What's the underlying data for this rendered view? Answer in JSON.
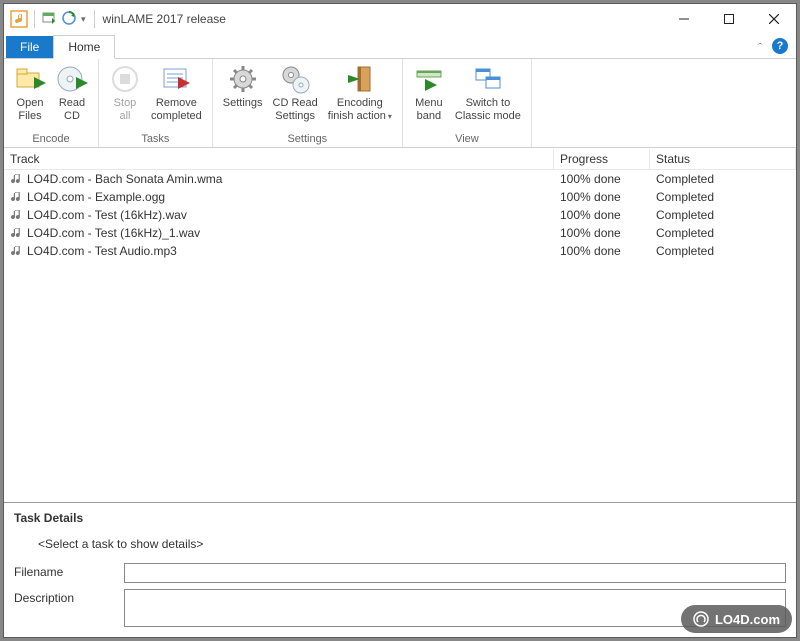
{
  "window": {
    "title": "winLAME 2017 release"
  },
  "tabs": {
    "file": "File",
    "home": "Home"
  },
  "ribbon": {
    "groups": {
      "encode": {
        "label": "Encode",
        "open_files": "Open\nFiles",
        "read_cd": "Read\nCD"
      },
      "tasks": {
        "label": "Tasks",
        "stop_all": "Stop\nall",
        "remove_completed": "Remove\ncompleted"
      },
      "settings": {
        "label": "Settings",
        "settings": "Settings",
        "cd_read": "CD Read\nSettings",
        "encoding_finish": "Encoding\nfinish action"
      },
      "view": {
        "label": "View",
        "menu_band": "Menu\nband",
        "classic": "Switch to\nClassic mode"
      }
    }
  },
  "columns": {
    "track": "Track",
    "progress": "Progress",
    "status": "Status"
  },
  "rows": [
    {
      "track": "LO4D.com - Bach Sonata Amin.wma",
      "progress": "100% done",
      "status": "Completed"
    },
    {
      "track": "LO4D.com - Example.ogg",
      "progress": "100% done",
      "status": "Completed"
    },
    {
      "track": "LO4D.com - Test (16kHz).wav",
      "progress": "100% done",
      "status": "Completed"
    },
    {
      "track": "LO4D.com - Test (16kHz)_1.wav",
      "progress": "100% done",
      "status": "Completed"
    },
    {
      "track": "LO4D.com - Test Audio.mp3",
      "progress": "100% done",
      "status": "Completed"
    }
  ],
  "details": {
    "title": "Task Details",
    "hint": "<Select a task to show details>",
    "filename_label": "Filename",
    "description_label": "Description",
    "filename_value": "",
    "description_value": ""
  },
  "watermark": "LO4D.com"
}
